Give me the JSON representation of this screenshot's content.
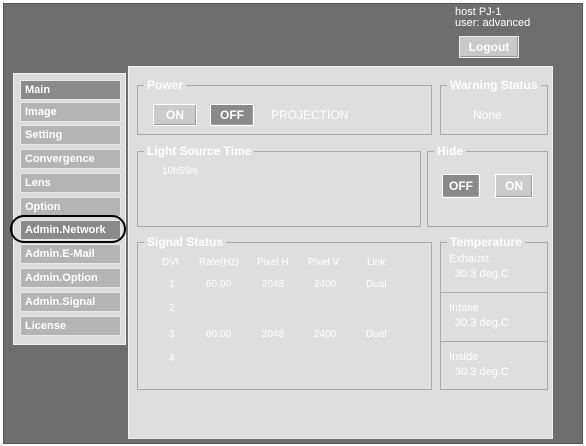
{
  "header": {
    "host": "host PJ-1",
    "user": "user: advanced",
    "logout_label": "Logout"
  },
  "sidebar": {
    "items": [
      {
        "label": "Main"
      },
      {
        "label": "Image"
      },
      {
        "label": "Setting"
      },
      {
        "label": "Convergence"
      },
      {
        "label": "Lens"
      },
      {
        "label": "Option"
      },
      {
        "label": "Admin.Network"
      },
      {
        "label": "Admin.E-Mail"
      },
      {
        "label": "Admin.Option"
      },
      {
        "label": "Admin.Signal"
      },
      {
        "label": "License"
      }
    ]
  },
  "power": {
    "title": "Power",
    "on_label": "ON",
    "off_label": "OFF",
    "status": "PROJECTION"
  },
  "warning": {
    "title": "Warning Status",
    "value": "None"
  },
  "light_source": {
    "title": "Light Source Time",
    "value": "10h59m"
  },
  "hide": {
    "title": "Hide",
    "off_label": "OFF",
    "on_label": "ON"
  },
  "signal": {
    "title": "Signal Status",
    "headers": [
      "DVI",
      "Rate(Hz)",
      "Pixel H",
      "Pixel V",
      "Link"
    ],
    "rows": [
      [
        "1",
        "60.00",
        "2048",
        "2400",
        "Dual"
      ],
      [
        "2",
        "",
        "",
        "",
        ""
      ],
      [
        "3",
        "60.00",
        "2048",
        "2400",
        "Dual"
      ],
      [
        "4",
        "",
        "",
        "",
        ""
      ]
    ]
  },
  "temperature": {
    "title": "Temperature",
    "items": [
      {
        "label": "Exhaust",
        "value": "30.3 deg.C"
      },
      {
        "label": "Intake",
        "value": "30.3 deg.C"
      },
      {
        "label": "Inside",
        "value": "30.3 deg.C"
      }
    ]
  },
  "colors": {
    "frame_bg": "#6e6e6e",
    "panel_bg": "#dedede",
    "button_light": "#cbcbcb",
    "button_dark": "#8a8a8a",
    "text": "#ffffff"
  }
}
